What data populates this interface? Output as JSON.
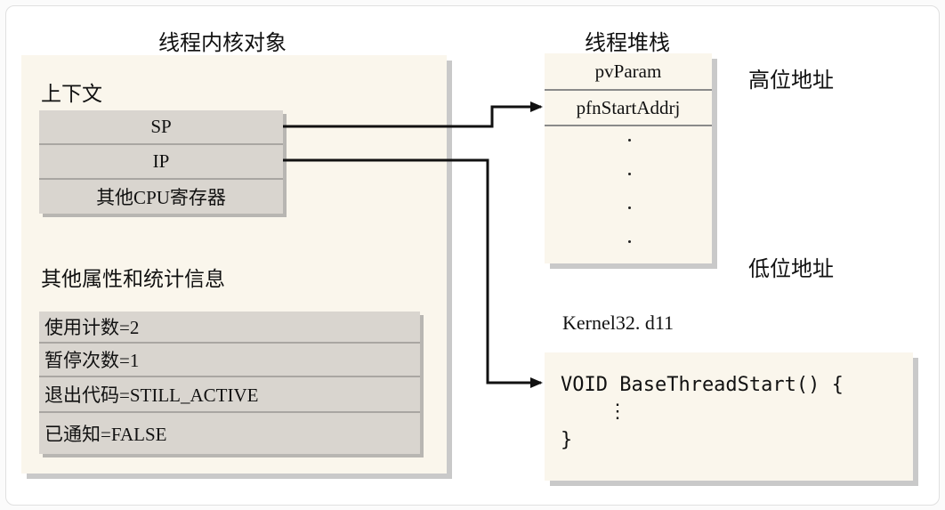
{
  "kernel_object": {
    "title": "线程内核对象",
    "context_label": "上下文",
    "registers": [
      "SP",
      "IP",
      "其他CPU寄存器"
    ],
    "other_label": "其他属性和统计信息",
    "attributes": [
      "使用计数=2",
      "暂停次数=1",
      "退出代码=STILL_ACTIVE",
      "已通知=FALSE"
    ]
  },
  "thread_stack": {
    "title": "线程堆栈",
    "rows": [
      "pvParam",
      "pfnStartAddrj"
    ],
    "high_label": "高位地址",
    "low_label": "低位地址"
  },
  "dll": {
    "name": "Kernel32. d11",
    "code_lines": [
      "VOID BaseThreadStart() {",
      "    ⋮",
      "}"
    ]
  }
}
